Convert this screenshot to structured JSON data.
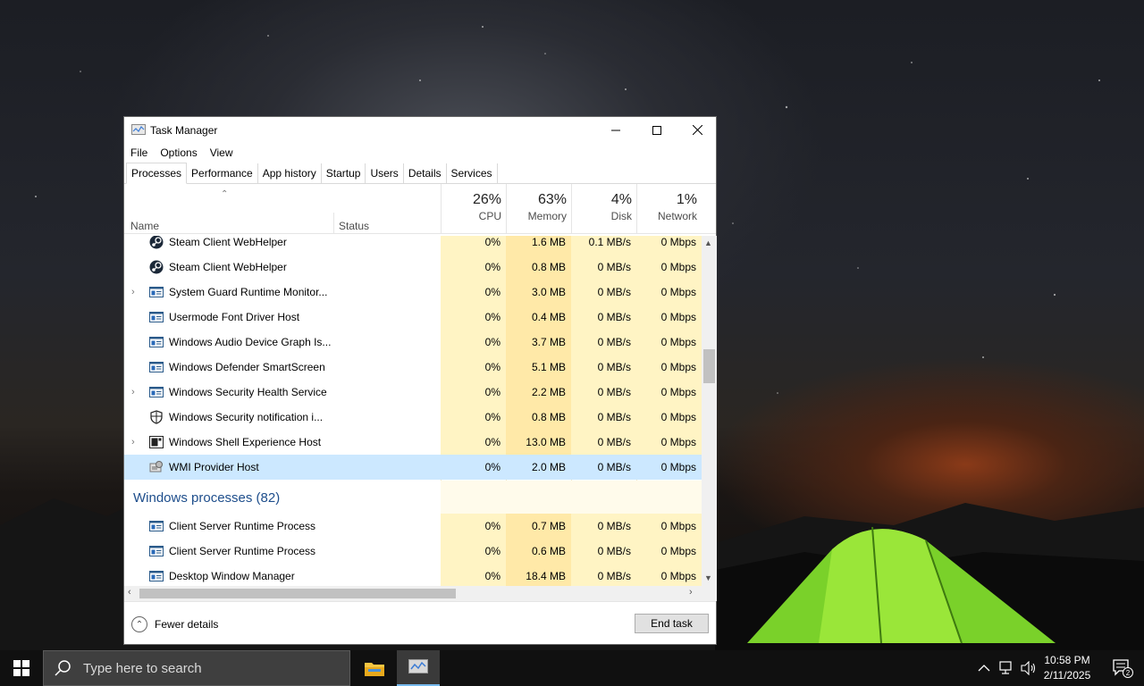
{
  "window": {
    "title": "Task Manager",
    "menu": [
      "File",
      "Options",
      "View"
    ],
    "tabs": [
      "Processes",
      "Performance",
      "App history",
      "Startup",
      "Users",
      "Details",
      "Services"
    ],
    "active_tab": "Processes"
  },
  "columns": {
    "name": "Name",
    "status": "Status",
    "cpu": {
      "pct": "26%",
      "label": "CPU"
    },
    "memory": {
      "pct": "63%",
      "label": "Memory"
    },
    "disk": {
      "pct": "4%",
      "label": "Disk"
    },
    "network": {
      "pct": "1%",
      "label": "Network"
    }
  },
  "rows": [
    {
      "name": "Steam Client WebHelper",
      "icon": "steam-icon",
      "expand": false,
      "cpu": "0%",
      "mem": "1.6 MB",
      "disk": "0.1 MB/s",
      "net": "0 Mbps"
    },
    {
      "name": "Steam Client WebHelper",
      "icon": "steam-icon",
      "expand": false,
      "cpu": "0%",
      "mem": "0.8 MB",
      "disk": "0 MB/s",
      "net": "0 Mbps"
    },
    {
      "name": "System Guard Runtime Monitor...",
      "icon": "process-icon",
      "expand": true,
      "cpu": "0%",
      "mem": "3.0 MB",
      "disk": "0 MB/s",
      "net": "0 Mbps"
    },
    {
      "name": "Usermode Font Driver Host",
      "icon": "process-icon",
      "expand": false,
      "cpu": "0%",
      "mem": "0.4 MB",
      "disk": "0 MB/s",
      "net": "0 Mbps"
    },
    {
      "name": "Windows Audio Device Graph Is...",
      "icon": "process-icon",
      "expand": false,
      "cpu": "0%",
      "mem": "3.7 MB",
      "disk": "0 MB/s",
      "net": "0 Mbps"
    },
    {
      "name": "Windows Defender SmartScreen",
      "icon": "process-icon",
      "expand": false,
      "cpu": "0%",
      "mem": "5.1 MB",
      "disk": "0 MB/s",
      "net": "0 Mbps"
    },
    {
      "name": "Windows Security Health Service",
      "icon": "process-icon",
      "expand": true,
      "cpu": "0%",
      "mem": "2.2 MB",
      "disk": "0 MB/s",
      "net": "0 Mbps"
    },
    {
      "name": "Windows Security notification i...",
      "icon": "shield-icon",
      "expand": false,
      "cpu": "0%",
      "mem": "0.8 MB",
      "disk": "0 MB/s",
      "net": "0 Mbps"
    },
    {
      "name": "Windows Shell Experience Host",
      "icon": "shell-icon",
      "expand": true,
      "cpu": "0%",
      "mem": "13.0 MB",
      "disk": "0 MB/s",
      "net": "0 Mbps"
    },
    {
      "name": "WMI Provider Host",
      "icon": "wmi-icon",
      "expand": false,
      "cpu": "0%",
      "mem": "2.0 MB",
      "disk": "0 MB/s",
      "net": "0 Mbps",
      "selected": true
    }
  ],
  "group": {
    "label": "Windows processes (82)"
  },
  "group_rows": [
    {
      "name": "Client Server Runtime Process",
      "icon": "process-icon",
      "expand": false,
      "cpu": "0%",
      "mem": "0.7 MB",
      "disk": "0 MB/s",
      "net": "0 Mbps"
    },
    {
      "name": "Client Server Runtime Process",
      "icon": "process-icon",
      "expand": false,
      "cpu": "0%",
      "mem": "0.6 MB",
      "disk": "0 MB/s",
      "net": "0 Mbps"
    },
    {
      "name": "Desktop Window Manager",
      "icon": "process-icon",
      "expand": false,
      "cpu": "0%",
      "mem": "18.4 MB",
      "disk": "0 MB/s",
      "net": "0 Mbps"
    }
  ],
  "footer": {
    "fewer_details": "Fewer details",
    "end_task": "End task"
  },
  "taskbar": {
    "search_placeholder": "Type here to search",
    "time": "10:58 PM",
    "date": "2/11/2025",
    "notification_count": "2"
  }
}
